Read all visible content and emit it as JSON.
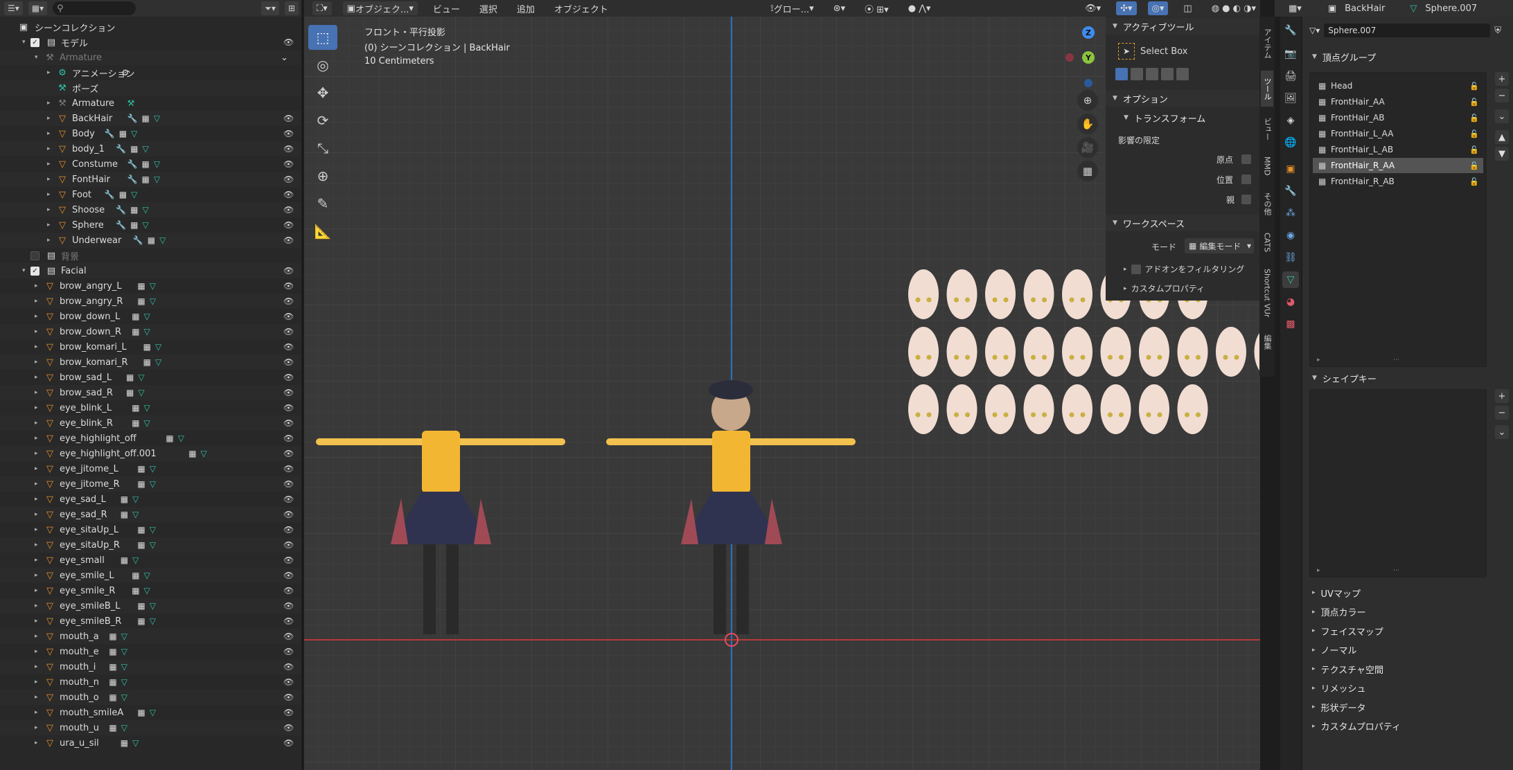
{
  "outliner": {
    "search_placeholder": "",
    "scene_collection": "シーンコレクション",
    "rows": [
      {
        "label": "モデル",
        "type": "collection",
        "depth": 1,
        "tri": "▾",
        "check": true,
        "eye": true
      },
      {
        "label": "Armature",
        "type": "armature",
        "depth": 2,
        "tri": "▾",
        "dim": true,
        "eye": false,
        "extra": "⌄"
      },
      {
        "label": "アニメーション",
        "type": "anim",
        "depth": 3,
        "tri": "▸",
        "mods": [
          "anim"
        ],
        "eye": false
      },
      {
        "label": "ポーズ",
        "type": "pose",
        "depth": 3,
        "tri": "",
        "eye": false
      },
      {
        "label": "Armature",
        "type": "armature",
        "depth": 3,
        "tri": "▸",
        "mods": [
          "bone"
        ],
        "eye": false
      },
      {
        "label": "BackHair",
        "type": "mesh",
        "depth": 3,
        "tri": "▸",
        "mods": [
          "wrench",
          "vgrp",
          "tri"
        ],
        "eye": true,
        "sel": false
      },
      {
        "label": "Body",
        "type": "mesh",
        "depth": 3,
        "tri": "▸",
        "mods": [
          "wrench",
          "vgrp",
          "tri"
        ],
        "eye": true
      },
      {
        "label": "body_1",
        "type": "mesh",
        "depth": 3,
        "tri": "▸",
        "mods": [
          "wrench",
          "vgrp",
          "tri"
        ],
        "eye": true
      },
      {
        "label": "Constume",
        "type": "mesh",
        "depth": 3,
        "tri": "▸",
        "mods": [
          "wrench",
          "vgrp",
          "tri"
        ],
        "eye": true
      },
      {
        "label": "FontHair",
        "type": "mesh",
        "depth": 3,
        "tri": "▸",
        "mods": [
          "wrench",
          "vgrp",
          "tri"
        ],
        "eye": true
      },
      {
        "label": "Foot",
        "type": "mesh",
        "depth": 3,
        "tri": "▸",
        "mods": [
          "wrench",
          "vgrp",
          "tri"
        ],
        "eye": true
      },
      {
        "label": "Shoose",
        "type": "mesh",
        "depth": 3,
        "tri": "▸",
        "mods": [
          "wrench",
          "vgrp",
          "tri"
        ],
        "eye": true
      },
      {
        "label": "Sphere",
        "type": "mesh",
        "depth": 3,
        "tri": "▸",
        "mods": [
          "wrench",
          "vgrp",
          "tri"
        ],
        "eye": true
      },
      {
        "label": "Underwear",
        "type": "mesh",
        "depth": 3,
        "tri": "▸",
        "mods": [
          "wrench",
          "vgrp",
          "tri"
        ],
        "eye": true
      },
      {
        "label": "背景",
        "type": "collection",
        "depth": 1,
        "tri": "",
        "check": false,
        "dim": true,
        "eye": false
      },
      {
        "label": "Facial",
        "type": "collection",
        "depth": 1,
        "tri": "▾",
        "check": true,
        "eye": true
      },
      {
        "label": "brow_angry_L",
        "type": "mesh",
        "depth": 2,
        "tri": "▸",
        "mods": [
          "vgrp",
          "tri"
        ],
        "eye": true
      },
      {
        "label": "brow_angry_R",
        "type": "mesh",
        "depth": 2,
        "tri": "▸",
        "mods": [
          "vgrp",
          "tri"
        ],
        "eye": true
      },
      {
        "label": "brow_down_L",
        "type": "mesh",
        "depth": 2,
        "tri": "▸",
        "mods": [
          "vgrp",
          "tri"
        ],
        "eye": true
      },
      {
        "label": "brow_down_R",
        "type": "mesh",
        "depth": 2,
        "tri": "▸",
        "mods": [
          "vgrp",
          "tri"
        ],
        "eye": true
      },
      {
        "label": "brow_komari_L",
        "type": "mesh",
        "depth": 2,
        "tri": "▸",
        "mods": [
          "vgrp",
          "tri"
        ],
        "eye": true
      },
      {
        "label": "brow_komari_R",
        "type": "mesh",
        "depth": 2,
        "tri": "▸",
        "mods": [
          "vgrp",
          "tri"
        ],
        "eye": true
      },
      {
        "label": "brow_sad_L",
        "type": "mesh",
        "depth": 2,
        "tri": "▸",
        "mods": [
          "vgrp",
          "tri"
        ],
        "eye": true
      },
      {
        "label": "brow_sad_R",
        "type": "mesh",
        "depth": 2,
        "tri": "▸",
        "mods": [
          "vgrp",
          "tri"
        ],
        "eye": true
      },
      {
        "label": "eye_blink_L",
        "type": "mesh",
        "depth": 2,
        "tri": "▸",
        "mods": [
          "vgrp",
          "tri"
        ],
        "eye": true
      },
      {
        "label": "eye_blink_R",
        "type": "mesh",
        "depth": 2,
        "tri": "▸",
        "mods": [
          "vgrp",
          "tri"
        ],
        "eye": true
      },
      {
        "label": "eye_highlight_off",
        "type": "mesh",
        "depth": 2,
        "tri": "▸",
        "mods": [
          "vgrp",
          "tri"
        ],
        "eye": true
      },
      {
        "label": "eye_highlight_off.001",
        "type": "mesh",
        "depth": 2,
        "tri": "▸",
        "mods": [
          "vgrp",
          "tri"
        ],
        "eye": true
      },
      {
        "label": "eye_jitome_L",
        "type": "mesh",
        "depth": 2,
        "tri": "▸",
        "mods": [
          "vgrp",
          "tri"
        ],
        "eye": true
      },
      {
        "label": "eye_jitome_R",
        "type": "mesh",
        "depth": 2,
        "tri": "▸",
        "mods": [
          "vgrp",
          "tri"
        ],
        "eye": true
      },
      {
        "label": "eye_sad_L",
        "type": "mesh",
        "depth": 2,
        "tri": "▸",
        "mods": [
          "vgrp",
          "tri"
        ],
        "eye": true
      },
      {
        "label": "eye_sad_R",
        "type": "mesh",
        "depth": 2,
        "tri": "▸",
        "mods": [
          "vgrp",
          "tri"
        ],
        "eye": true
      },
      {
        "label": "eye_sitaUp_L",
        "type": "mesh",
        "depth": 2,
        "tri": "▸",
        "mods": [
          "vgrp",
          "tri"
        ],
        "eye": true
      },
      {
        "label": "eye_sitaUp_R",
        "type": "mesh",
        "depth": 2,
        "tri": "▸",
        "mods": [
          "vgrp",
          "tri"
        ],
        "eye": true
      },
      {
        "label": "eye_small",
        "type": "mesh",
        "depth": 2,
        "tri": "▸",
        "mods": [
          "vgrp",
          "tri"
        ],
        "eye": true
      },
      {
        "label": "eye_smile_L",
        "type": "mesh",
        "depth": 2,
        "tri": "▸",
        "mods": [
          "vgrp",
          "tri"
        ],
        "eye": true
      },
      {
        "label": "eye_smile_R",
        "type": "mesh",
        "depth": 2,
        "tri": "▸",
        "mods": [
          "vgrp",
          "tri"
        ],
        "eye": true
      },
      {
        "label": "eye_smileB_L",
        "type": "mesh",
        "depth": 2,
        "tri": "▸",
        "mods": [
          "vgrp",
          "tri"
        ],
        "eye": true
      },
      {
        "label": "eye_smileB_R",
        "type": "mesh",
        "depth": 2,
        "tri": "▸",
        "mods": [
          "vgrp",
          "tri"
        ],
        "eye": true
      },
      {
        "label": "mouth_a",
        "type": "mesh",
        "depth": 2,
        "tri": "▸",
        "mods": [
          "vgrp",
          "tri"
        ],
        "eye": true
      },
      {
        "label": "mouth_e",
        "type": "mesh",
        "depth": 2,
        "tri": "▸",
        "mods": [
          "vgrp",
          "tri"
        ],
        "eye": true
      },
      {
        "label": "mouth_i",
        "type": "mesh",
        "depth": 2,
        "tri": "▸",
        "mods": [
          "vgrp",
          "tri"
        ],
        "eye": true
      },
      {
        "label": "mouth_n",
        "type": "mesh",
        "depth": 2,
        "tri": "▸",
        "mods": [
          "vgrp",
          "tri"
        ],
        "eye": true
      },
      {
        "label": "mouth_o",
        "type": "mesh",
        "depth": 2,
        "tri": "▸",
        "mods": [
          "vgrp",
          "tri"
        ],
        "eye": true
      },
      {
        "label": "mouth_smileA",
        "type": "mesh",
        "depth": 2,
        "tri": "▸",
        "mods": [
          "vgrp",
          "tri"
        ],
        "eye": true
      },
      {
        "label": "mouth_u",
        "type": "mesh",
        "depth": 2,
        "tri": "▸",
        "mods": [
          "vgrp",
          "tri"
        ],
        "eye": true
      },
      {
        "label": "ura_u_sil",
        "type": "mesh",
        "depth": 2,
        "tri": "▸",
        "mods": [
          "vgrp",
          "tri"
        ],
        "eye": true
      }
    ]
  },
  "viewport": {
    "header": {
      "mode": "オブジェク...",
      "view": "ビュー",
      "select": "選択",
      "add": "追加",
      "object": "オブジェクト",
      "orientation": "グロー..."
    },
    "info": {
      "line1": "フロント・平行投影",
      "line2": "(0) シーンコレクション | BackHair",
      "line3": "10 Centimeters"
    },
    "gizmo": {
      "z": "Z",
      "y": "Y",
      "x": "X"
    }
  },
  "npanel": {
    "active_tool": "アクティブツール",
    "tool_name": "Select Box",
    "options": "オプション",
    "transform": "トランスフォーム",
    "affect_only": "影響の限定",
    "origins": "原点",
    "locations": "位置",
    "parents": "親",
    "workspace": "ワークスペース",
    "mode_label": "モード",
    "mode_value": "編集モード",
    "filter_addons": "アドオンをフィルタリング",
    "custom_props": "カスタムプロパティ",
    "tabs": [
      "アイテム",
      "ツール",
      "ビュー",
      "MMD",
      "その他",
      "CATS",
      "Shortcut VUr",
      "編集"
    ]
  },
  "properties": {
    "header_object": "BackHair",
    "header_data": "Sphere.007",
    "mesh_name": "Sphere.007",
    "vertex_groups_title": "頂点グループ",
    "vertex_groups": [
      "Head",
      "FrontHair_AA",
      "FrontHair_AB",
      "FrontHair_L_AA",
      "FrontHair_L_AB",
      "FrontHair_R_AA",
      "FrontHair_R_AB"
    ],
    "selected_group": "FrontHair_R_AA",
    "shape_keys_title": "シェイプキー",
    "collapsed": [
      "UVマップ",
      "頂点カラー",
      "フェイスマップ",
      "ノーマル",
      "テクスチャ空間",
      "リメッシュ",
      "形状データ",
      "カスタムプロパティ"
    ]
  },
  "colors": {
    "accent": "#4772b3",
    "mesh_icon": "#e8902c",
    "data_icon": "#2fc3a8",
    "axis_x": "#e84a5f",
    "axis_y": "#8cc43f",
    "axis_z": "#3f8cf0"
  }
}
